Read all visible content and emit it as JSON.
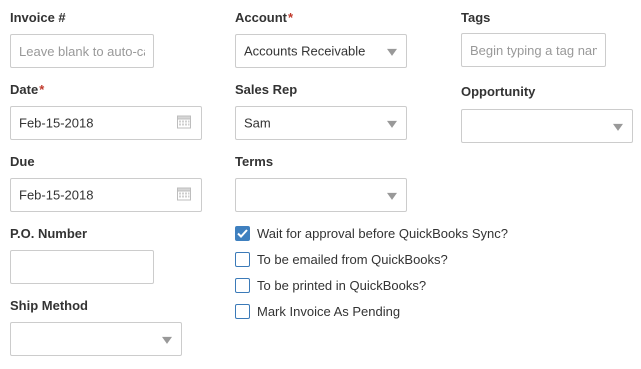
{
  "form": {
    "invoice_number": {
      "label": "Invoice #",
      "placeholder": "Leave blank to auto-ca",
      "value": ""
    },
    "account": {
      "label": "Account",
      "required_mark": "*",
      "selected": "Accounts Receivable"
    },
    "tags": {
      "label": "Tags",
      "placeholder": "Begin typing a tag name"
    },
    "date": {
      "label": "Date",
      "required_mark": "*",
      "value": "Feb-15-2018"
    },
    "sales_rep": {
      "label": "Sales Rep",
      "selected": "Sam"
    },
    "opportunity": {
      "label": "Opportunity",
      "selected": ""
    },
    "due": {
      "label": "Due",
      "value": "Feb-15-2018"
    },
    "terms": {
      "label": "Terms",
      "selected": ""
    },
    "po_number": {
      "label": "P.O. Number",
      "value": ""
    },
    "ship_method": {
      "label": "Ship Method",
      "selected": ""
    },
    "checkboxes": [
      {
        "label": "Wait for approval before QuickBooks Sync?",
        "checked": true
      },
      {
        "label": "To be emailed from QuickBooks?",
        "checked": false
      },
      {
        "label": "To be printed in QuickBooks?",
        "checked": false
      },
      {
        "label": "Mark Invoice As Pending",
        "checked": false
      }
    ]
  },
  "colors": {
    "required": "#c0392b",
    "checkbox_checked": "#3f80bf",
    "border": "#cccccc"
  },
  "icons": {
    "dropdown": "chevron-down-icon",
    "date_picker": "calendar-icon",
    "checkbox": "check-icon"
  }
}
